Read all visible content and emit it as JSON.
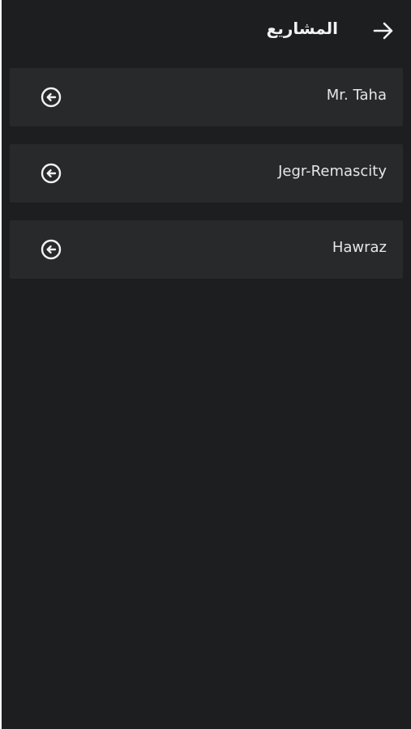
{
  "header": {
    "title": "المشاريع",
    "back_icon": "arrow-right-icon"
  },
  "projects": [
    {
      "label": "Mr. Taha",
      "icon": "circle-arrow-left-icon"
    },
    {
      "label": "Jegr-Remascity",
      "icon": "circle-arrow-left-icon"
    },
    {
      "label": "Hawraz",
      "icon": "circle-arrow-left-icon"
    }
  ],
  "colors": {
    "background": "#1d1e20",
    "card": "#28292b",
    "text": "#e6e6e6"
  }
}
